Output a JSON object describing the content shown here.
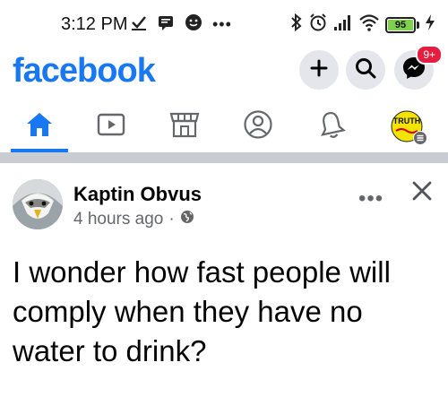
{
  "status_bar": {
    "time": "3:12 PM",
    "battery_level": "95"
  },
  "header": {
    "logo": "facebook",
    "messenger_badge": "9+"
  },
  "nav": {
    "active_tab": "home",
    "tabs": [
      "home",
      "watch",
      "marketplace",
      "profile",
      "notifications",
      "menu"
    ]
  },
  "post": {
    "author": "Kaptin Obvus",
    "time_ago": "4 hours ago",
    "separator": "·",
    "text": "I wonder how fast people will comply when they have no water to drink?"
  },
  "colors": {
    "brand": "#1877f2",
    "badge": "#e41e3f",
    "secondary_text": "#65676b"
  },
  "icons": [
    "check-icon",
    "message-icon",
    "smiley-icon",
    "bluetooth-icon",
    "alarm-icon",
    "signal-icon",
    "wifi-icon",
    "charging-icon",
    "plus-icon",
    "search-icon",
    "messenger-icon",
    "home-icon",
    "watch-icon",
    "marketplace-icon",
    "profile-icon",
    "bell-icon",
    "menu-avatar-icon",
    "globe-icon",
    "more-icon",
    "close-icon"
  ]
}
